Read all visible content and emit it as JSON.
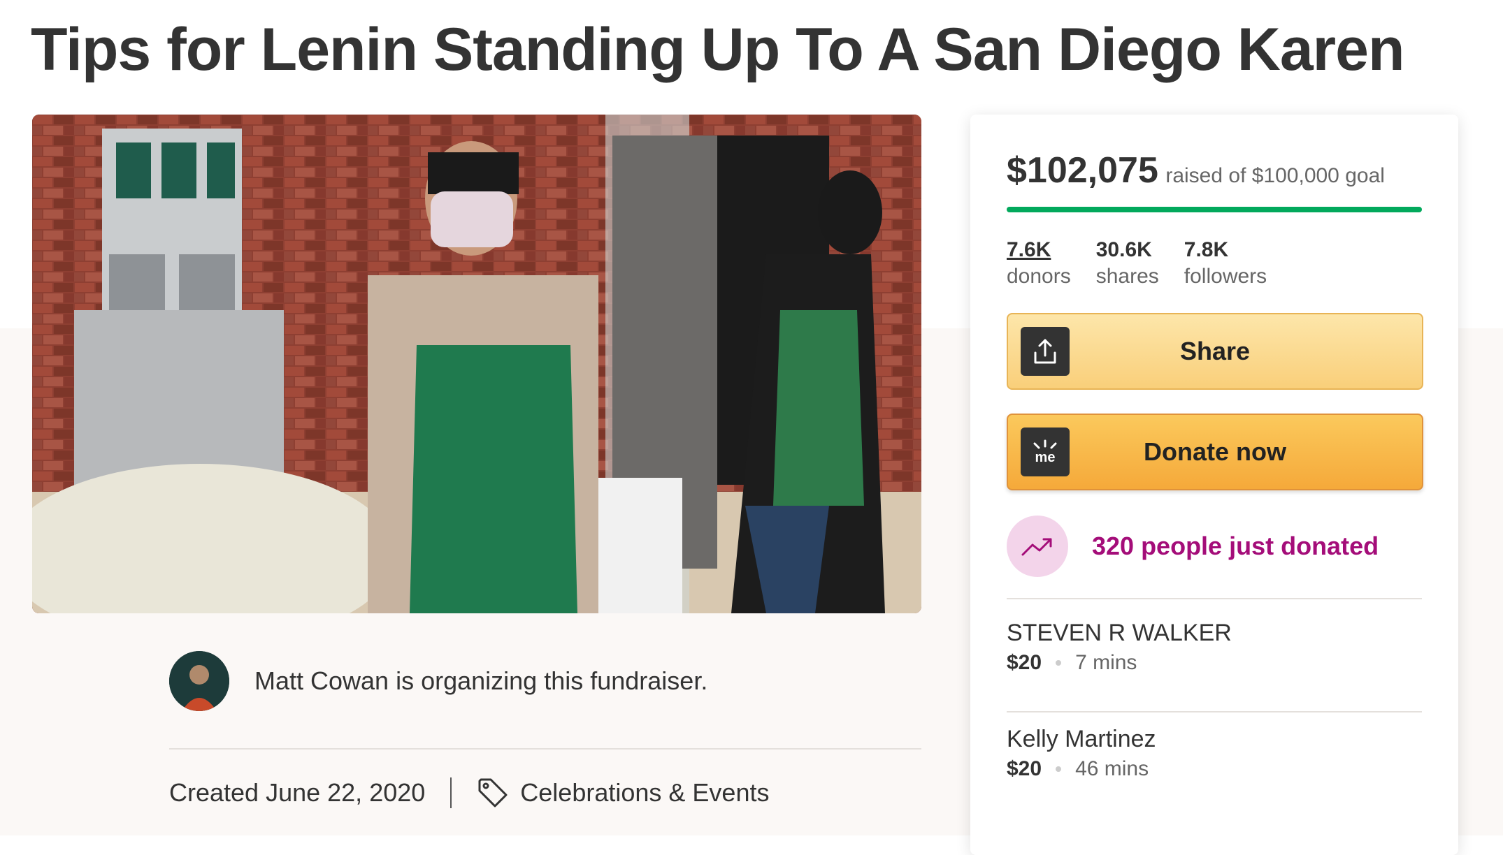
{
  "page": {
    "title": "Tips for Lenin Standing Up To A San Diego Karen"
  },
  "organizer": {
    "text": "Matt Cowan is organizing this fundraiser."
  },
  "meta": {
    "created": "Created June 22, 2020",
    "category": "Celebrations & Events"
  },
  "campaign": {
    "raised": "$102,075",
    "goal_text": "raised of $100,000 goal",
    "progress_fraction": 1.0,
    "accent_color": "#02a95c"
  },
  "stats": [
    {
      "value": "7.6K",
      "label": "donors"
    },
    {
      "value": "30.6K",
      "label": "shares"
    },
    {
      "value": "7.8K",
      "label": "followers"
    }
  ],
  "buttons": {
    "share": "Share",
    "donate": "Donate now"
  },
  "trend": {
    "text": "320 people just donated",
    "color": "#a40d79"
  },
  "donations": [
    {
      "name": "STEVEN R WALKER",
      "amount": "$20",
      "time": "7 mins"
    },
    {
      "name": "Kelly Martinez",
      "amount": "$20",
      "time": "46 mins"
    }
  ],
  "icons": [
    "share-icon",
    "gofundme-logo-icon",
    "trending-up-icon",
    "tag-icon"
  ]
}
